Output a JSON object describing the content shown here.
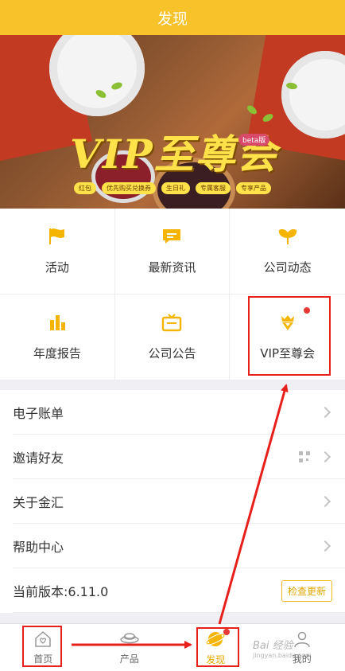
{
  "header": {
    "title": "发现"
  },
  "banner": {
    "title": "VIP至尊会",
    "beta": "beta版",
    "tags": [
      "红包",
      "优先购买兑换券",
      "生日礼",
      "专属客服",
      "专享产品"
    ]
  },
  "grid": [
    {
      "label": "活动",
      "icon": "flag-icon"
    },
    {
      "label": "最新资讯",
      "icon": "chat-icon"
    },
    {
      "label": "公司动态",
      "icon": "ginkgo-leaf-icon"
    },
    {
      "label": "年度报告",
      "icon": "bar-chart-icon"
    },
    {
      "label": "公司公告",
      "icon": "tv-icon"
    },
    {
      "label": "VIP至尊会",
      "icon": "crown-diamond-icon",
      "badge": true
    }
  ],
  "list": {
    "e_statement": "电子账单",
    "invite": "邀请好友",
    "about": "关于金汇",
    "help": "帮助中心",
    "version": "当前版本:6.11.0",
    "check_update": "检查更新"
  },
  "tabs": [
    {
      "label": "首页",
      "icon": "home-icon"
    },
    {
      "label": "产品",
      "icon": "ingot-icon"
    },
    {
      "label": "发现",
      "icon": "planet-icon",
      "active": true,
      "badge": true
    },
    {
      "label": "我的",
      "icon": "user-icon"
    }
  ],
  "watermark": {
    "main": "Bai 经验",
    "sub": "jingyan.baidu.com"
  },
  "colors": {
    "brand": "#f7c22a",
    "annotation": "#e8201c",
    "badge": "#e53935"
  }
}
